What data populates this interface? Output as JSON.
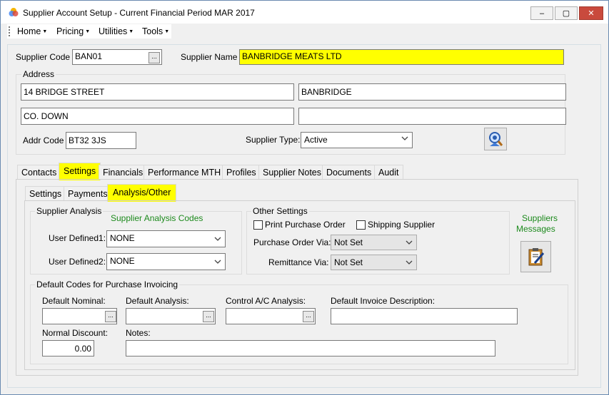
{
  "window": {
    "title": "Supplier Account Setup - Current Financial Period MAR 2017",
    "controls": {
      "minimize": "–",
      "maximize": "▢",
      "close": "✕"
    }
  },
  "menu": [
    "Home",
    "Pricing",
    "Utilities",
    "Tools"
  ],
  "supplier": {
    "code_label": "Supplier Code",
    "code": "BAN01",
    "name_label": "Supplier Name",
    "name": "BANBRIDGE MEATS LTD",
    "lookup": "..."
  },
  "address": {
    "legend": "Address",
    "line1": "14 BRIDGE STREET",
    "line2": "BANBRIDGE",
    "line3": "CO. DOWN",
    "line4": "",
    "addr_code_label": "Addr Code",
    "addr_code": "BT32 3JS",
    "supplier_type_label": "Supplier Type:",
    "supplier_type": "Active"
  },
  "main_tabs": [
    "Contacts",
    "Settings",
    "Financials",
    "Performance MTH",
    "Profiles",
    "Supplier Notes",
    "Documents",
    "Audit"
  ],
  "sub_tabs": [
    "Settings",
    "Payments",
    "Analysis/Other"
  ],
  "analysis": {
    "legend": "Supplier Analysis",
    "codes_title": "Supplier Analysis Codes",
    "ud1_label": "User Defined1:",
    "ud1_value": "NONE",
    "ud2_label": "User Defined2:",
    "ud2_value": "NONE"
  },
  "other": {
    "legend": "Other Settings",
    "print_po_label": "Print Purchase Order",
    "shipping_label": "Shipping Supplier",
    "po_via_label": "Purchase Order Via:",
    "po_via": "Not Set",
    "remit_via_label": "Remittance Via:",
    "remit_via": "Not Set"
  },
  "messages": {
    "label_line1": "Suppliers",
    "label_line2": "Messages"
  },
  "defaults": {
    "legend": "Default Codes for Purchase Invoicing",
    "nominal_label": "Default Nominal:",
    "nominal": "",
    "analysis_label": "Default Analysis:",
    "analysis": "",
    "control_label": "Control A/C Analysis:",
    "control": "",
    "desc_label": "Default Invoice Description:",
    "desc": "",
    "discount_label": "Normal Discount:",
    "discount": "0.00",
    "notes_label": "Notes:",
    "notes": "",
    "lookup": "..."
  },
  "colors": {
    "highlight": "#ffff00",
    "green_text": "#1d8a1d",
    "close_button": "#c94a3d"
  }
}
